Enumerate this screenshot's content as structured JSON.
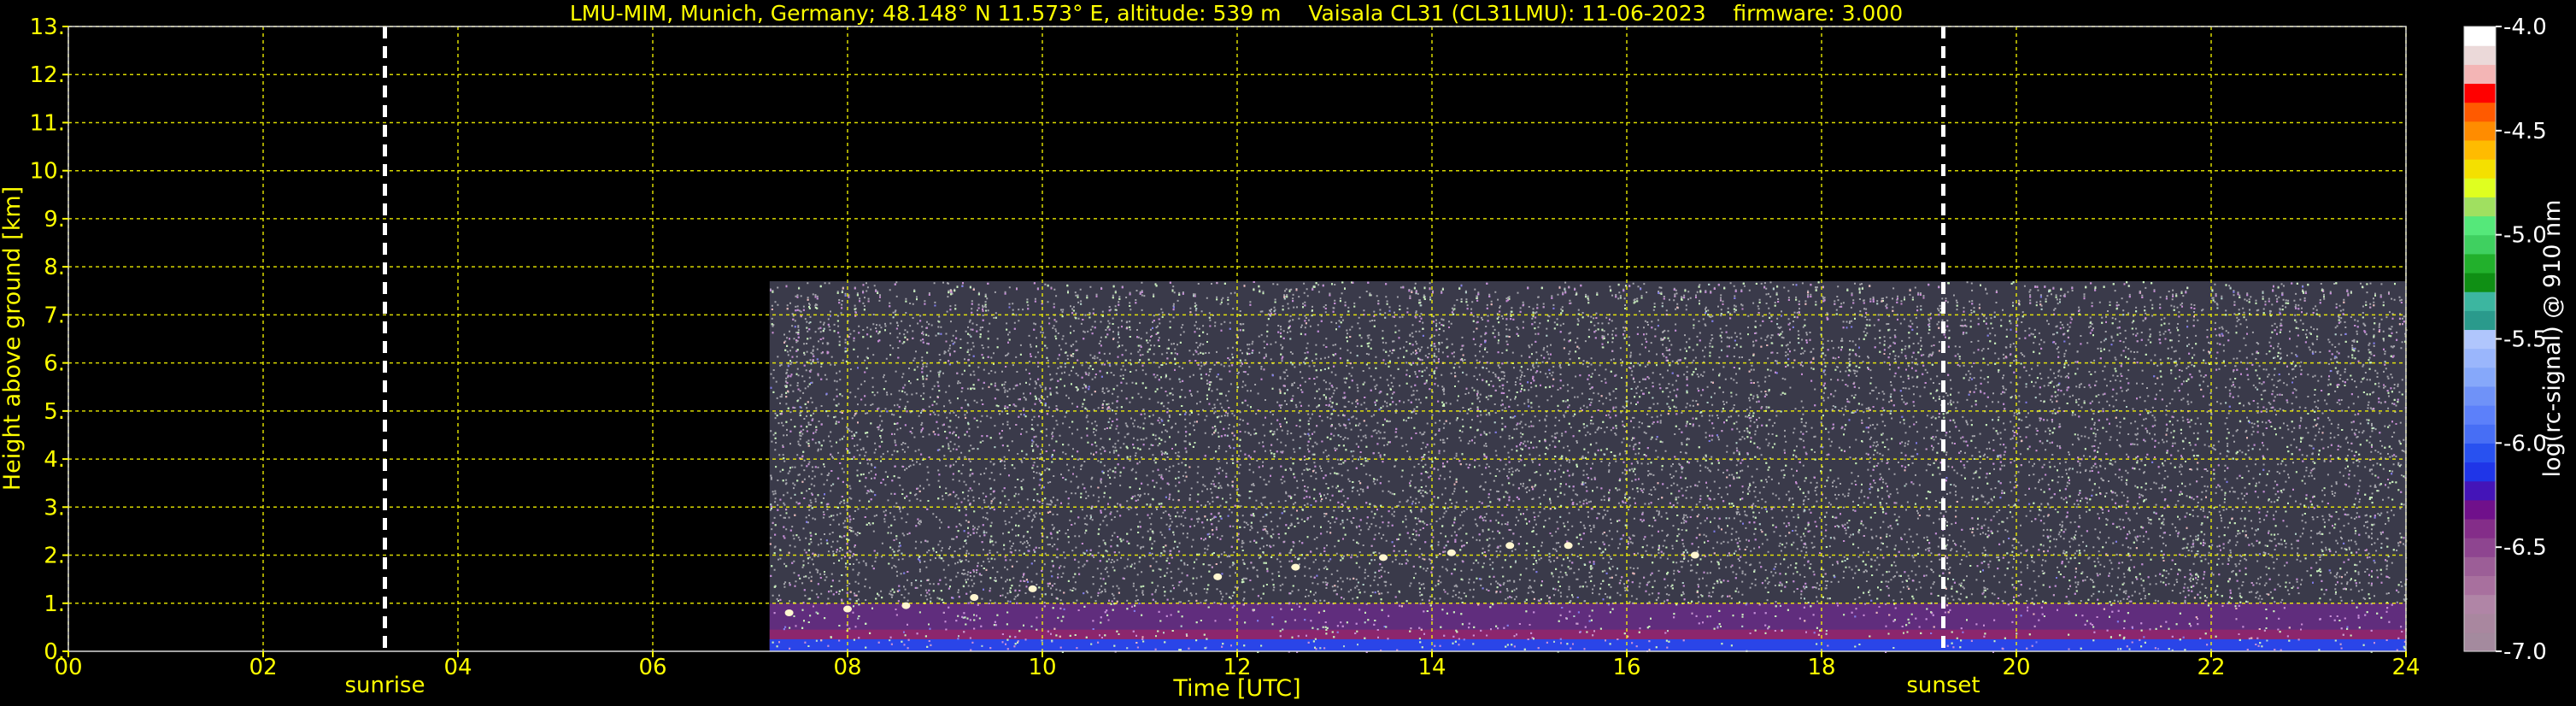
{
  "chart_data": {
    "type": "heatmap",
    "title": "LMU-MIM, Munich, Germany; 48.148° N 11.573° E, altitude: 539 m    Vaisala CL31 (CL31LMU): 11-06-2023    firmware: 3.000",
    "xlabel": "Time [UTC]",
    "ylabel": "Height above ground [km]",
    "xlim": [
      0,
      24
    ],
    "ylim": [
      0,
      13
    ],
    "x_tick_labels": [
      "00",
      "02",
      "04",
      "06",
      "08",
      "10",
      "12",
      "14",
      "16",
      "18",
      "20",
      "22",
      "24"
    ],
    "y_tick_labels": [
      "0.",
      "1.",
      "2.",
      "3.",
      "4.",
      "5.",
      "6.",
      "7.",
      "8.",
      "9.",
      "10.",
      "11.",
      "12.",
      "13."
    ],
    "grid": true,
    "events": [
      {
        "label": "sunrise",
        "time": 3.25
      },
      {
        "label": "sunset",
        "time": 19.25
      }
    ],
    "data_coverage": {
      "start": 7.2,
      "end": 24,
      "max_height": 7.7
    },
    "cloud_layer": [
      {
        "time": 7.4,
        "height": 0.8
      },
      {
        "time": 8.0,
        "height": 0.88
      },
      {
        "time": 8.6,
        "height": 0.95
      },
      {
        "time": 9.3,
        "height": 1.12
      },
      {
        "time": 9.9,
        "height": 1.3
      },
      {
        "time": 11.8,
        "height": 1.55
      },
      {
        "time": 12.6,
        "height": 1.75
      },
      {
        "time": 13.5,
        "height": 1.95
      },
      {
        "time": 14.2,
        "height": 2.05
      },
      {
        "time": 14.8,
        "height": 2.2
      },
      {
        "time": 15.4,
        "height": 2.2
      },
      {
        "time": 16.7,
        "height": 2.0
      }
    ],
    "colorbar": {
      "label": "log(rc-signal) @ 910 nm",
      "range": [
        -7.0,
        -4.0
      ],
      "tick_labels": [
        "-7.0",
        "-6.5",
        "-6.0",
        "-5.5",
        "-5.0",
        "-4.5",
        "-4.0"
      ],
      "colors": [
        "#a48a9e",
        "#a9879f",
        "#b085a6",
        "#a8709e",
        "#9c5e97",
        "#8e4590",
        "#842d89",
        "#70108b",
        "#4414b8",
        "#1f35e8",
        "#2851f0",
        "#476ef5",
        "#5c80fa",
        "#6f92f8",
        "#86a8fa",
        "#9ab6fc",
        "#b0c6fd",
        "#2a9a8c",
        "#3cb6a0",
        "#0f8f14",
        "#22b02c",
        "#3fd060",
        "#55e87a",
        "#a0e060",
        "#dfff20",
        "#f4e000",
        "#ffbb00",
        "#ff8c00",
        "#ff5a00",
        "#ff0000",
        "#f3b5b5",
        "#ebd9d9",
        "#ffffff"
      ]
    }
  }
}
